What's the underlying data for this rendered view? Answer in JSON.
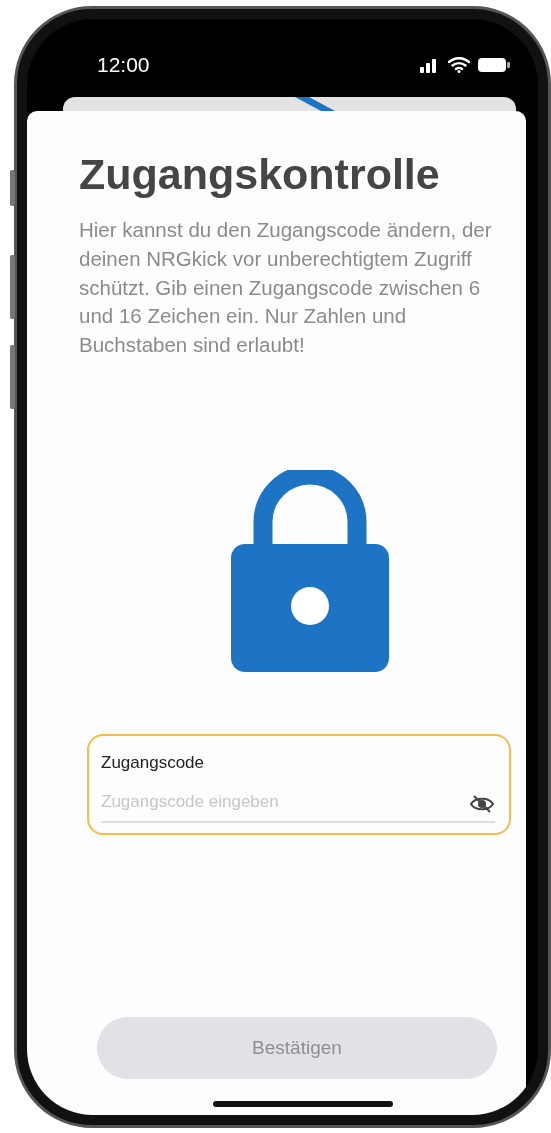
{
  "status_bar": {
    "time": "12:00"
  },
  "title": "Zugangskontrolle",
  "description": "Hier kannst du den Zugangscode ändern, der deinen NRGkick vor unberechtigtem Zugriff schützt. Gib einen Zugangscode zwischen 6 und 16 Zeichen ein. Nur Zahlen und Buchstaben sind erlaubt!",
  "code_field": {
    "label": "Zugangscode",
    "placeholder": "Zugangscode eingeben",
    "focused": true,
    "hidden": true
  },
  "confirm_button": {
    "label": "Bestätigen",
    "disabled": true
  }
}
